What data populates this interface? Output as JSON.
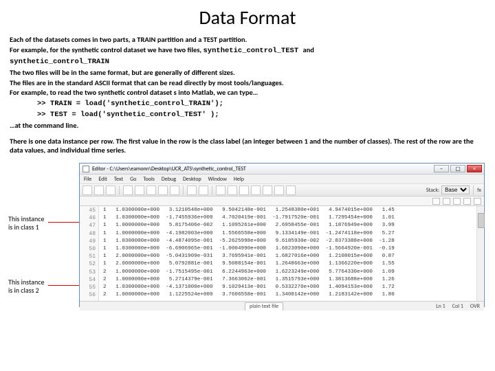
{
  "title": "Data Format",
  "para": {
    "p1": "Each of the datasets comes in two parts, a TRAIN partition and a TEST partition.",
    "p2a": "For example, for the synthetic control dataset we have two files, ",
    "p2b": "synthetic_control_TEST ",
    "p2c": "and",
    "p3": "synthetic_control_TRAIN",
    "p4": "The two files will be in the same format, but are generally of different sizes.",
    "p5": "The files are in the standard ASCII format that can be read directly by most tools/languages.",
    "p6": "For example, to read the two synthetic control dataset s into Matlab, we can type…",
    "p7": ">> TRAIN = load('synthetic_control_TRAIN');",
    "p8": ">> TEST  = load('synthetic_control_TEST' );",
    "p9": "…at the command line.",
    "p10": "There is one data instance per row. The first value in the row is the class label (an integer between 1 and the number of classes). The rest of the row are the data values, and individual time series."
  },
  "anno": {
    "a1": "This instance is in class 1",
    "a2": "This instance is in class 2"
  },
  "editor": {
    "window_title": "Editor - C:\\Users\\eamonn\\Desktop\\UCR_ATS\\synthetic_control_TEST",
    "menus": [
      "File",
      "Edit",
      "Text",
      "Go",
      "Tools",
      "Debug",
      "Desktop",
      "Window",
      "Help"
    ],
    "stack_label": "Stack:",
    "stack_value": "Base",
    "fx": "fx",
    "tab": "plain text file",
    "status": {
      "ln": "Ln 1",
      "col": "Col 1",
      "ovr": "OVR"
    },
    "gutter": [
      "45",
      "46",
      "47",
      "48",
      "49",
      "50",
      "51",
      "52",
      "53",
      "54",
      "55",
      "56"
    ],
    "rows": [
      "1   1.0300000e+000   3.1210548e+000   9.5042148e-001   1.2548380e+001   4.9474015e+000   1.45",
      "1   1.0300000e+000  -1.7455936e+000   4.7020419e-001  -1.7917520e-001   1.7295454e+000   1.01",
      "1   1.0000000e+000   5.8175406e-002   1.1095261e+000   2.6958455e-001   1.1876949e+000   3.99",
      "1   1.0000000e+000  -4.1982003e+000   1.5566558e+000   9.1334149e-001  -1.2474118e+000   5.27",
      "1   1.0300000e+000  -4.4874095e-001  -5.2625998e+000   9.6185930e-002  -2.8373388e+000  -1.28",
      "1   1.0300000e+000  -6.6906965e-001  -1.0004990e+000   1.6023090e+000  -1.5664920e-001  -0.19",
      "1   2.0000000e+000  -5.0431909e-031   3.7695941e-001   1.6827016e+000   1.2108015e+000   0.87",
      "1   2.0000000e+000   5.0792881e-001   9.5088154e-001   1.2648663e+000   1.1366220e+000   1.55",
      "2   1.0000000e+000  -1.7515495e-001   6.2244963e+000   1.6223249e+000   5.7764330e+000   1.09",
      "2   1.0000000e+000   5.2714379e-001   7.3663062e-001   1.3515793e+000   1.3813688e+000   1.26",
      "2   1.0300000e+000  -4.1371000e+000   9.1029413e-001   0.5332270e+000   1.4094153e+000   1.72",
      "2   1.0000000e+000   1.1225524e+000   3.7606558e-001   1.3408142e+000   1.2183142e+000   1.80"
    ]
  }
}
